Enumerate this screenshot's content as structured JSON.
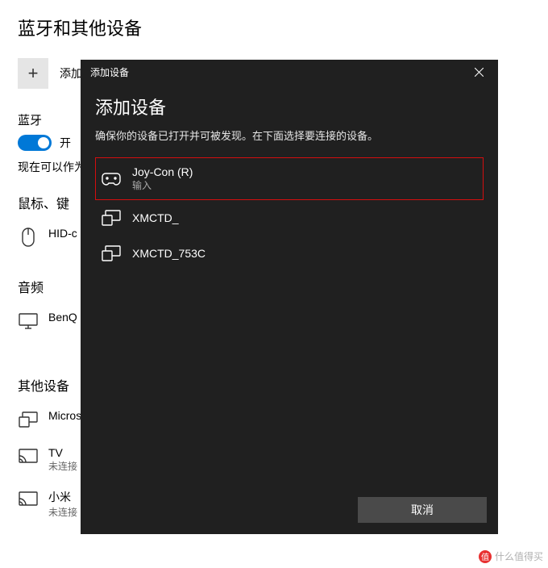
{
  "page": {
    "title": "蓝牙和其他设备",
    "add_label": "添加蓝牙或其他设备",
    "bt_head": "蓝牙",
    "bt_state": "开",
    "discover": "现在可以作为",
    "categories": {
      "mouse_kb": "鼠标、键",
      "audio": "音频",
      "other": "其他设备"
    },
    "devices": {
      "hid": {
        "name": "HID-c"
      },
      "benq": {
        "name": "BenQ"
      },
      "ms": {
        "name": "Micros"
      },
      "tv": {
        "name": "TV",
        "sub": "未连接"
      },
      "mi": {
        "name": "小米",
        "sub": "未连接"
      }
    }
  },
  "modal": {
    "window_title": "添加设备",
    "heading": "添加设备",
    "subtitle": "确保你的设备已打开并可被发现。在下面选择要连接的设备。",
    "cancel": "取消",
    "list": [
      {
        "name": "Joy-Con (R)",
        "type": "输入",
        "icon": "gamepad",
        "highlight": true
      },
      {
        "name": "XMCTD_",
        "type": "",
        "icon": "display"
      },
      {
        "name": "XMCTD_753C",
        "type": "",
        "icon": "display"
      }
    ]
  },
  "watermark": {
    "char": "值",
    "text": "什么值得买"
  }
}
